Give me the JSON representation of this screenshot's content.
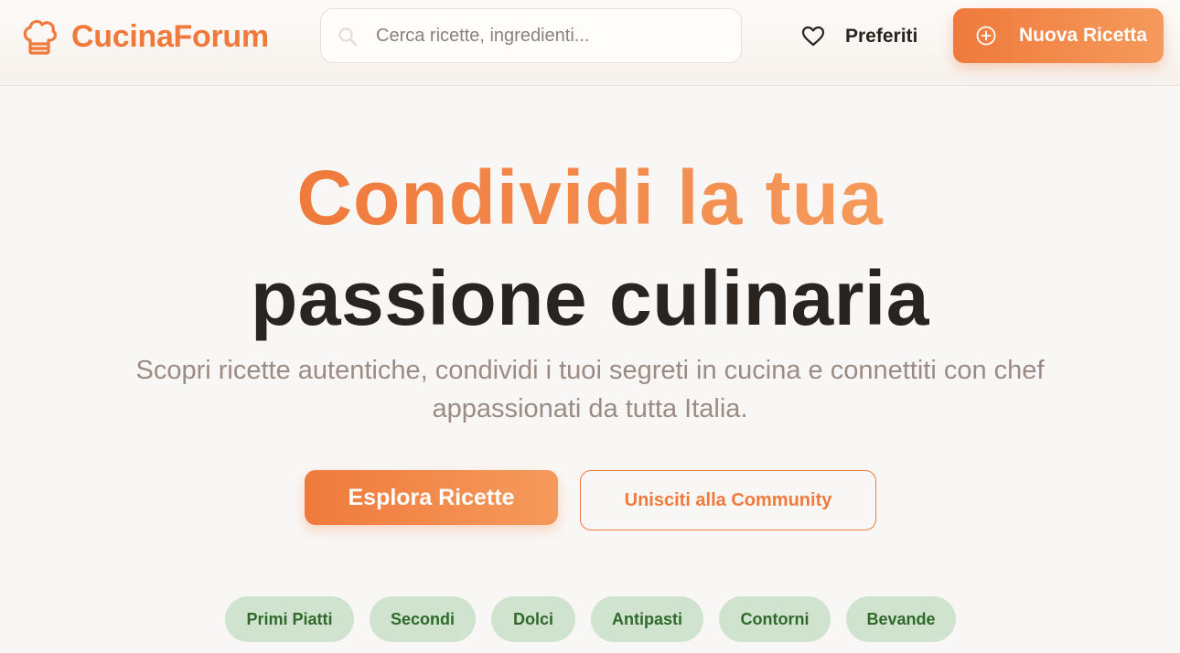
{
  "header": {
    "logo_text": "CucinaForum",
    "logo_icon": "chef-hat-icon",
    "search": {
      "placeholder": "Cerca ricette, ingredienti...",
      "value": ""
    },
    "favorites_label": "Preferiti",
    "favorites_icon": "heart-icon",
    "new_recipe_label": "Nuova Ricetta",
    "new_recipe_icon": "plus-circle-icon"
  },
  "hero": {
    "title_line1": "Condividi la tua",
    "title_line2": "passione culinaria",
    "subtitle": "Scopri ricette autentiche, condividi i tuoi segreti in cucina e connettiti con chef appassionati da tutta Italia.",
    "primary_button": "Esplora Ricette",
    "secondary_button": "Unisciti alla Community"
  },
  "categories": [
    "Primi Piatti",
    "Secondi",
    "Dolci",
    "Antipasti",
    "Contorni",
    "Bevande"
  ],
  "colors": {
    "accent": "#ef7a3c",
    "accent_light": "#f59a5c",
    "text_dark": "#2a2420",
    "text_muted": "#9a8b84",
    "chip_bg": "#cfe3cf",
    "chip_text": "#2f6a2a",
    "background": "#f9f7f5"
  }
}
